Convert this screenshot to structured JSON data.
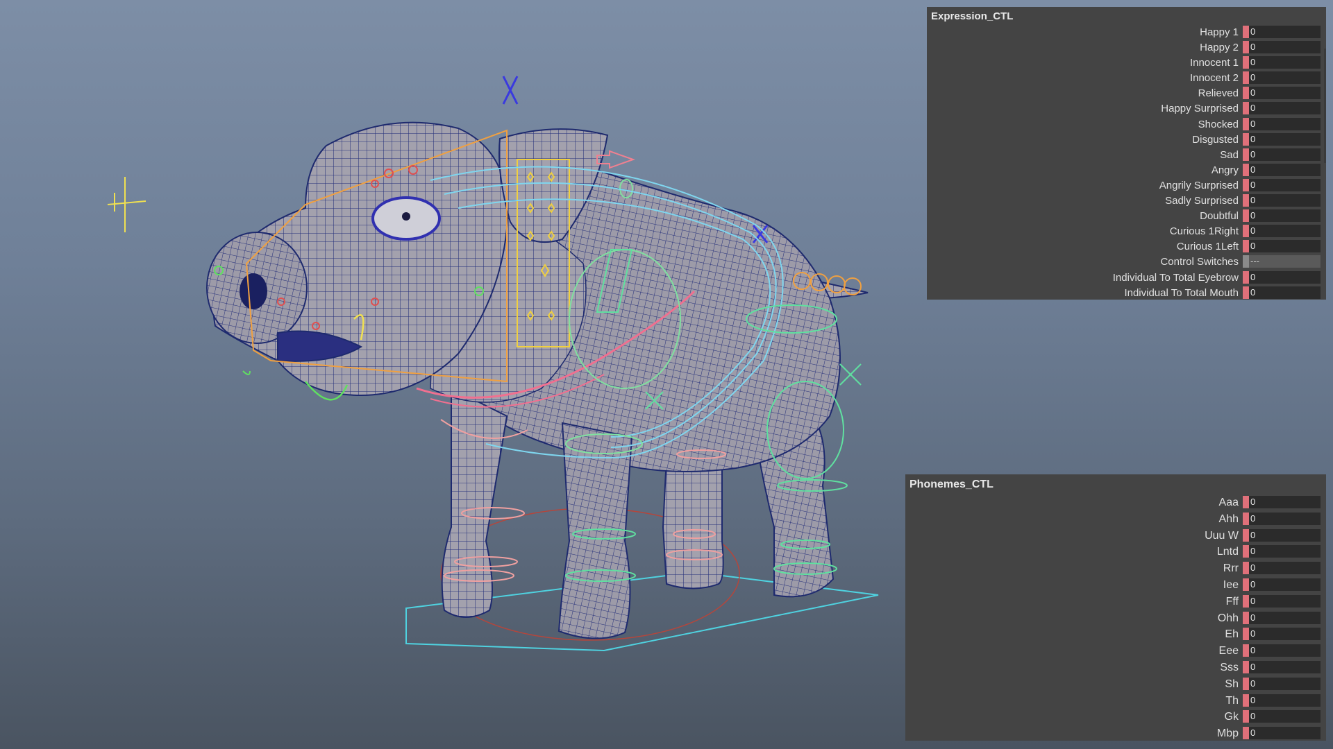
{
  "expression_panel": {
    "title": "Expression_CTL",
    "attributes": [
      {
        "label": "Happy 1",
        "value": "0"
      },
      {
        "label": "Happy 2",
        "value": "0"
      },
      {
        "label": "Innocent 1",
        "value": "0"
      },
      {
        "label": "Innocent 2",
        "value": "0"
      },
      {
        "label": "Relieved",
        "value": "0"
      },
      {
        "label": "Happy Surprised",
        "value": "0"
      },
      {
        "label": "Shocked",
        "value": "0"
      },
      {
        "label": "Disgusted",
        "value": "0"
      },
      {
        "label": "Sad",
        "value": "0"
      },
      {
        "label": "Angry",
        "value": "0"
      },
      {
        "label": "Angrily Surprised",
        "value": "0"
      },
      {
        "label": "Sadly Surprised",
        "value": "0"
      },
      {
        "label": "Doubtful",
        "value": "0"
      },
      {
        "label": "Curious 1Right",
        "value": "0"
      },
      {
        "label": "Curious 1Left",
        "value": "0"
      },
      {
        "label": "Control Switches",
        "value": "---"
      },
      {
        "label": "Individual To Total Eyebrow",
        "value": "0"
      },
      {
        "label": "Individual To Total Mouth",
        "value": "0"
      }
    ]
  },
  "phonemes_panel": {
    "title": "Phonemes_CTL",
    "attributes": [
      {
        "label": "Aaa",
        "value": "0"
      },
      {
        "label": "Ahh",
        "value": "0"
      },
      {
        "label": "Uuu W",
        "value": "0"
      },
      {
        "label": "Lntd",
        "value": "0"
      },
      {
        "label": "Rrr",
        "value": "0"
      },
      {
        "label": "Iee",
        "value": "0"
      },
      {
        "label": "Fff",
        "value": "0"
      },
      {
        "label": "Ohh",
        "value": "0"
      },
      {
        "label": "Eh",
        "value": "0"
      },
      {
        "label": "Eee",
        "value": "0"
      },
      {
        "label": "Sss",
        "value": "0"
      },
      {
        "label": "Sh",
        "value": "0"
      },
      {
        "label": "Th",
        "value": "0"
      },
      {
        "label": "Gk",
        "value": "0"
      },
      {
        "label": "Mbp",
        "value": "0"
      }
    ]
  },
  "colors": {
    "keyed": "#e0707a",
    "locked": "#8a8a8a",
    "panel": "#444444",
    "field": "#2b2b2b",
    "mesh_wire": "#1e2a6e",
    "mesh_fill": "#9a98a6"
  }
}
